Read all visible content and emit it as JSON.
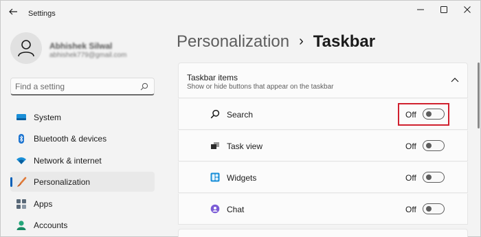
{
  "app": {
    "title": "Settings"
  },
  "profile": {
    "name": "Abhishek Silwal",
    "email": "abhishek779@gmail.com"
  },
  "search": {
    "placeholder": "Find a setting",
    "value": ""
  },
  "nav": {
    "items": [
      {
        "label": "System",
        "icon": "system-icon",
        "active": false
      },
      {
        "label": "Bluetooth & devices",
        "icon": "bluetooth-icon",
        "active": false
      },
      {
        "label": "Network & internet",
        "icon": "network-icon",
        "active": false
      },
      {
        "label": "Personalization",
        "icon": "brush-icon",
        "active": true
      },
      {
        "label": "Apps",
        "icon": "apps-icon",
        "active": false
      },
      {
        "label": "Accounts",
        "icon": "accounts-icon",
        "active": false
      }
    ]
  },
  "breadcrumb": {
    "parent": "Personalization",
    "separator": "›",
    "current": "Taskbar"
  },
  "section": {
    "title": "Taskbar items",
    "subtitle": "Show or hide buttons that appear on the taskbar",
    "expanded": true,
    "items": [
      {
        "label": "Search",
        "state": "Off",
        "on": false,
        "icon": "search-icon"
      },
      {
        "label": "Task view",
        "state": "Off",
        "on": false,
        "icon": "task-view-icon"
      },
      {
        "label": "Widgets",
        "state": "Off",
        "on": false,
        "icon": "widgets-icon"
      },
      {
        "label": "Chat",
        "state": "Off",
        "on": false,
        "icon": "chat-icon"
      }
    ]
  },
  "colors": {
    "accent": "#005fb8",
    "highlight": "#d0202e",
    "background": "#f3f3f3",
    "card": "#fbfbfb"
  }
}
